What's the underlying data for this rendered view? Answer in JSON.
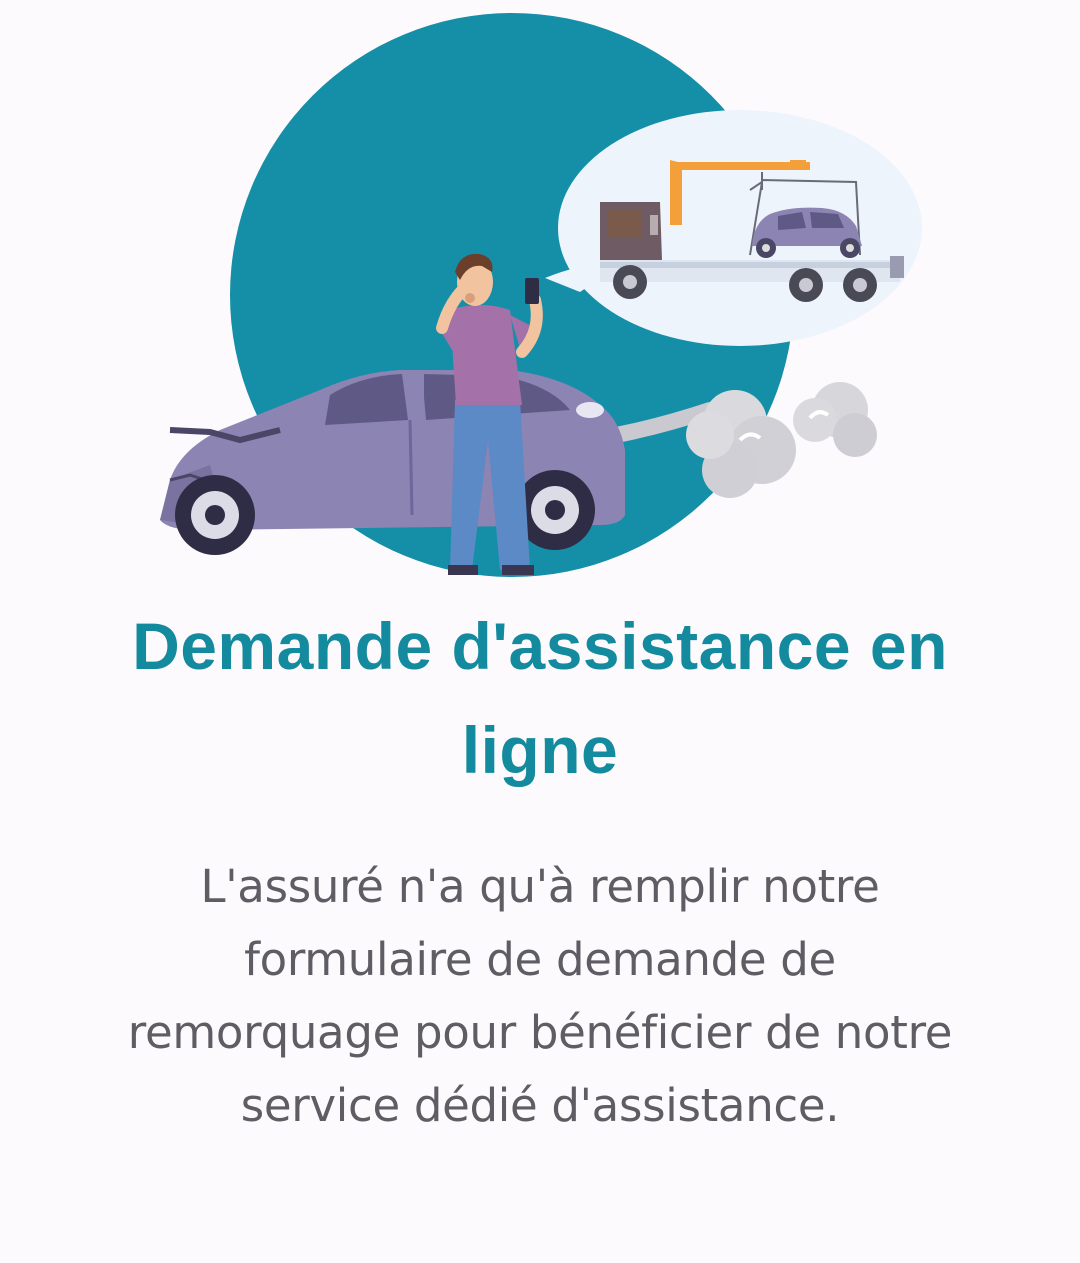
{
  "card": {
    "title": "Demande d'assistance en ligne",
    "description": "L'assuré n'a qu'à remplir notre formulaire de demande de remorquage pour bénéficier de notre service dédié d'assistance."
  },
  "illustration": {
    "icon": "car-accident-tow-truck-illustration"
  },
  "colors": {
    "accent": "#138a9d",
    "background": "#fdfafd",
    "body_text": "#5d5d63",
    "circle": "#158fa8",
    "car": "#8c84b3",
    "speech_bubble": "#eef4fc"
  }
}
